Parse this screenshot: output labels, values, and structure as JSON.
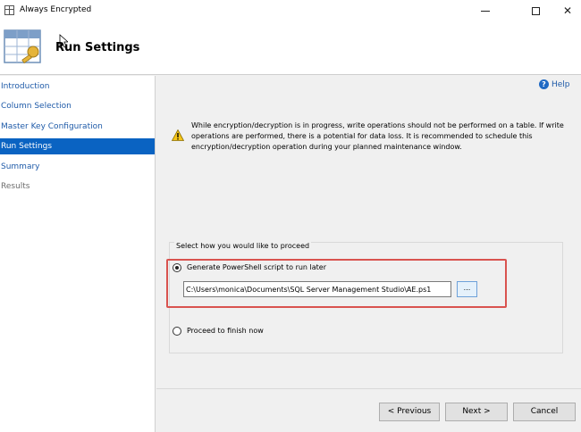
{
  "window": {
    "title": "Always Encrypted",
    "minimize_icon": "minimize-icon",
    "maximize_icon": "maximize-icon",
    "close_glyph": "✕"
  },
  "header": {
    "title": "Run Settings",
    "icon": "wizard-table-key-icon"
  },
  "sidebar": {
    "items": [
      {
        "label": "Introduction",
        "state": "link"
      },
      {
        "label": "Column Selection",
        "state": "link"
      },
      {
        "label": "Master Key Configuration",
        "state": "link"
      },
      {
        "label": "Run Settings",
        "state": "active"
      },
      {
        "label": "Summary",
        "state": "link"
      },
      {
        "label": "Results",
        "state": "disabled"
      }
    ]
  },
  "main": {
    "help": {
      "icon_glyph": "?",
      "label": "Help"
    },
    "warning": {
      "icon": "warning-icon",
      "text": "While encryption/decryption is in progress, write operations should not be performed on a table. If write operations are performed, there is a potential for data loss. It is recommended to schedule this encryption/decryption operation during your planned maintenance window."
    },
    "proceed_group": {
      "label": "Select how you would like to proceed",
      "options": [
        {
          "label": "Generate PowerShell script to run later",
          "selected": true
        },
        {
          "label": "Proceed to finish now",
          "selected": false
        }
      ],
      "script_path": "C:\\Users\\monica\\Documents\\SQL Server Management Studio\\AE.ps1",
      "browse_label": "..."
    }
  },
  "footer": {
    "previous_label": "< Previous",
    "next_label": "Next >",
    "cancel_label": "Cancel"
  },
  "colors": {
    "accent": "#0a63c2",
    "link": "#1e5aa8",
    "highlight": "#d9534f"
  }
}
